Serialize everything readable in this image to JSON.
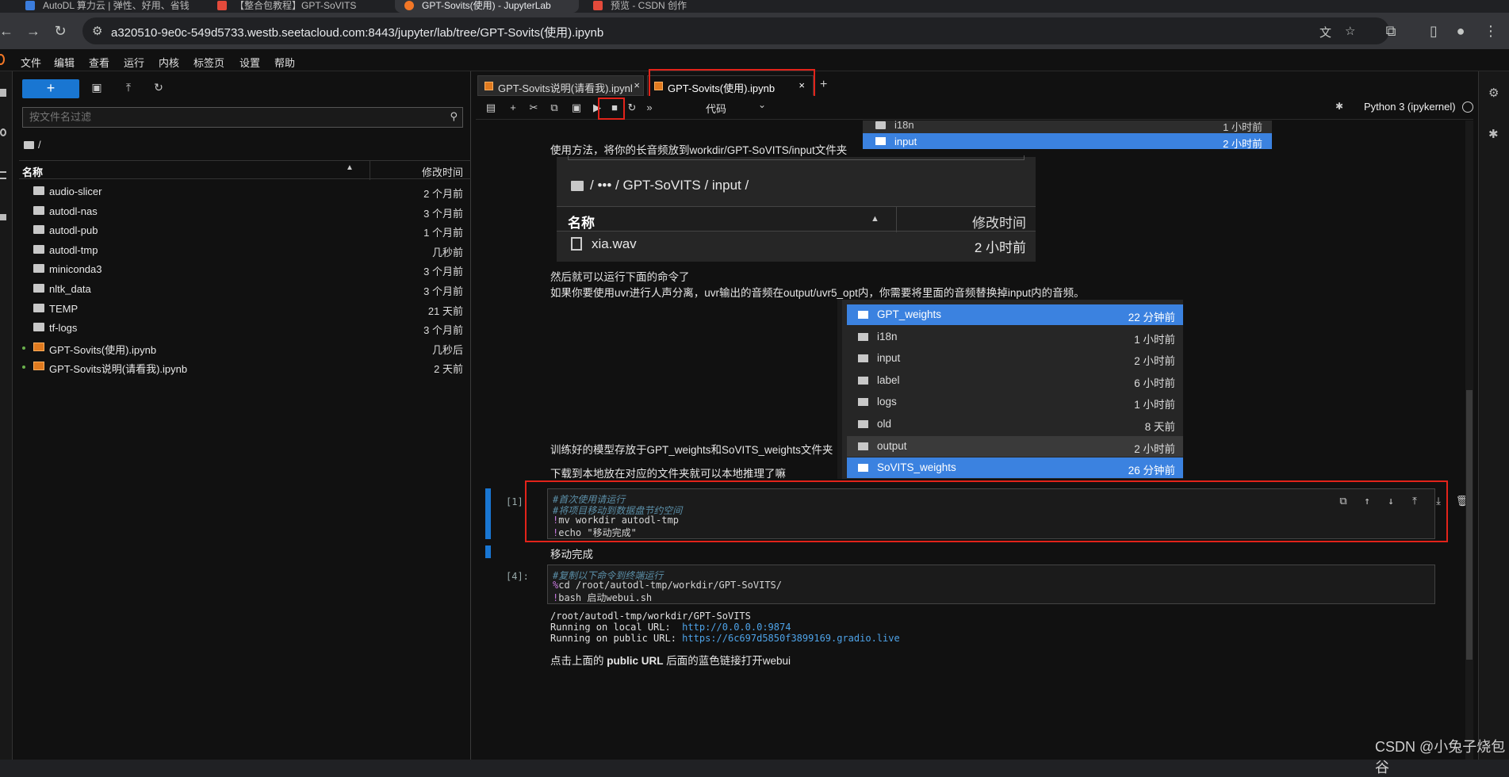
{
  "browser": {
    "tabs": [
      {
        "label": "AutoDL 算力云 | 弹性、好用、省钱"
      },
      {
        "label": "【整合包教程】GPT-SoVITS"
      },
      {
        "label": "GPT-Sovits(使用) - JupyterLab"
      },
      {
        "label": "预览 - CSDN 创作"
      }
    ],
    "url": "a320510-9e0c-549d5733.westb.seetacloud.com:8443/jupyter/lab/tree/GPT-Sovits(使用).ipynb"
  },
  "menubar": [
    "文件",
    "编辑",
    "查看",
    "运行",
    "内核",
    "标签页",
    "设置",
    "帮助"
  ],
  "file_browser": {
    "new_label": "+",
    "filter_placeholder": "按文件名过滤",
    "crumb": "/",
    "col_name": "名称",
    "col_modified": "修改时间",
    "rows": [
      {
        "name": "audio-slicer",
        "time": "2 个月前",
        "type": "folder"
      },
      {
        "name": "autodl-nas",
        "time": "3 个月前",
        "type": "folder"
      },
      {
        "name": "autodl-pub",
        "time": "1 个月前",
        "type": "folder"
      },
      {
        "name": "autodl-tmp",
        "time": "几秒前",
        "type": "folder"
      },
      {
        "name": "miniconda3",
        "time": "3 个月前",
        "type": "folder"
      },
      {
        "name": "nltk_data",
        "time": "3 个月前",
        "type": "folder"
      },
      {
        "name": "TEMP",
        "time": "21 天前",
        "type": "folder"
      },
      {
        "name": "tf-logs",
        "time": "3 个月前",
        "type": "folder"
      },
      {
        "name": "GPT-Sovits(使用).ipynb",
        "time": "几秒后",
        "type": "notebook"
      },
      {
        "name": "GPT-Sovits说明(请看我).ipynb",
        "time": "2 天前",
        "type": "notebook"
      }
    ]
  },
  "notebook_tabs": [
    {
      "label": "GPT-Sovits说明(请看我).ipynl"
    },
    {
      "label": "GPT-Sovits(使用).ipynb"
    }
  ],
  "toolbar": {
    "cell_type": "代码",
    "kernel": "Python 3 (ipykernel)"
  },
  "embed_top": {
    "rows": [
      {
        "name": "i18n",
        "time": "1 小时前"
      },
      {
        "name": "input",
        "time": "2 小时前"
      }
    ]
  },
  "md1": "使用方法，将你的长音频放到workdir/GPT-SoVITS/input文件夹",
  "embed_input": {
    "crumb": "/  •••  / GPT-SoVITS / input /",
    "col_name": "名称",
    "col_modified": "修改时间",
    "file": "xia.wav",
    "time": "2 小时前"
  },
  "md2": "然后就可以运行下面的命令了",
  "md3": "如果你要使用uvr进行人声分离，uvr输出的音频在output/uvr5_opt内，你需要将里面的音频替换掉input内的音频。",
  "embed_list": [
    {
      "name": "GPT_weights",
      "time": "22 分钟前",
      "hl": "blue"
    },
    {
      "name": "i18n",
      "time": "1 小时前",
      "hl": ""
    },
    {
      "name": "input",
      "time": "2 小时前",
      "hl": ""
    },
    {
      "name": "label",
      "time": "6 小时前",
      "hl": ""
    },
    {
      "name": "logs",
      "time": "1 小时前",
      "hl": ""
    },
    {
      "name": "old",
      "time": "8 天前",
      "hl": ""
    },
    {
      "name": "output",
      "time": "2 小时前",
      "hl": "grey"
    },
    {
      "name": "SoVITS_weights",
      "time": "26 分钟前",
      "hl": "blue"
    }
  ],
  "md4": "训练好的模型存放于GPT_weights和SoVITS_weights文件夹",
  "md5": "下载到本地放在对应的文件夹就可以本地推理了嘛",
  "cell1": {
    "prompt": "[1]:",
    "lines": [
      "#首次使用请运行",
      "#将项目移动到数据盘节约空间",
      "mv workdir autodl-tmp",
      "echo \"移动完成\""
    ],
    "output": "移动完成"
  },
  "cell2": {
    "prompt": "[4]:",
    "lines": [
      "#复制以下命令到终端运行",
      "cd /root/autodl-tmp/workdir/GPT-SoVITS/",
      "bash 启动webui.sh"
    ],
    "out1": "/root/autodl-tmp/workdir/GPT-SoVITS",
    "out2_label": "Running on local URL:  ",
    "out2_link": "http://0.0.0.0:9874",
    "out3_label": "Running on public URL: ",
    "out3_link": "https://6c697d5850f3899169.gradio.live"
  },
  "md6_a": "点击上面的 ",
  "md6_b": "public URL",
  "md6_c": " 后面的蓝色链接打开webui",
  "watermark": "CSDN @小兔子烧包谷"
}
